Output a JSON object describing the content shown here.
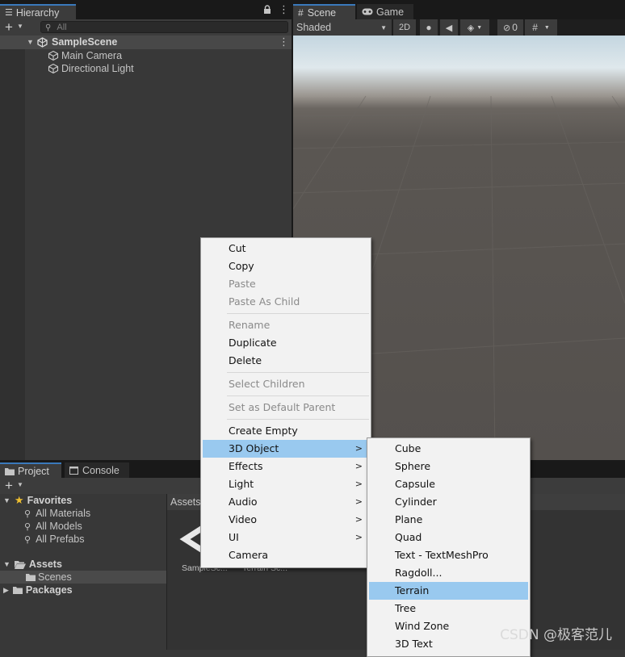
{
  "hierarchy": {
    "tab_label": "Hierarchy",
    "search_placeholder": "All",
    "scene_name": "SampleScene",
    "items": [
      "Main Camera",
      "Directional Light"
    ]
  },
  "scene_view": {
    "tabs": [
      "Scene",
      "Game"
    ],
    "shading_mode": "Shaded",
    "mode_2d": "2D",
    "hidden_count": "0"
  },
  "project": {
    "tabs": [
      "Project",
      "Console"
    ],
    "favorites_label": "Favorites",
    "favorites": [
      "All Materials",
      "All Models",
      "All Prefabs"
    ],
    "assets_label": "Assets",
    "assets_children": [
      "Scenes"
    ],
    "packages_label": "Packages",
    "breadcrumb": "Assets",
    "asset_tiles": [
      "SampleSc...",
      "Terrain Sc..."
    ]
  },
  "context_menu": {
    "items": [
      {
        "label": "Cut",
        "enabled": true
      },
      {
        "label": "Copy",
        "enabled": true
      },
      {
        "label": "Paste",
        "enabled": false
      },
      {
        "label": "Paste As Child",
        "enabled": false
      },
      {
        "label": "Rename",
        "enabled": false
      },
      {
        "label": "Duplicate",
        "enabled": true
      },
      {
        "label": "Delete",
        "enabled": true
      },
      {
        "label": "Select Children",
        "enabled": false
      },
      {
        "label": "Set as Default Parent",
        "enabled": false
      },
      {
        "label": "Create Empty",
        "enabled": true
      },
      {
        "label": "3D Object",
        "enabled": true,
        "submenu": true,
        "selected": true
      },
      {
        "label": "Effects",
        "enabled": true,
        "submenu": true
      },
      {
        "label": "Light",
        "enabled": true,
        "submenu": true
      },
      {
        "label": "Audio",
        "enabled": true,
        "submenu": true
      },
      {
        "label": "Video",
        "enabled": true,
        "submenu": true
      },
      {
        "label": "UI",
        "enabled": true,
        "submenu": true
      },
      {
        "label": "Camera",
        "enabled": true
      }
    ]
  },
  "submenu_3d": {
    "items": [
      "Cube",
      "Sphere",
      "Capsule",
      "Cylinder",
      "Plane",
      "Quad",
      "Text - TextMeshPro",
      "Ragdoll...",
      "Terrain",
      "Tree",
      "Wind Zone",
      "3D Text"
    ],
    "selected": "Terrain"
  },
  "watermark": "CSDN @极客范儿",
  "colors": {
    "accent_tab": "#3a79bb",
    "menu_highlight": "#99c9ef",
    "panel_bg": "#383838"
  }
}
